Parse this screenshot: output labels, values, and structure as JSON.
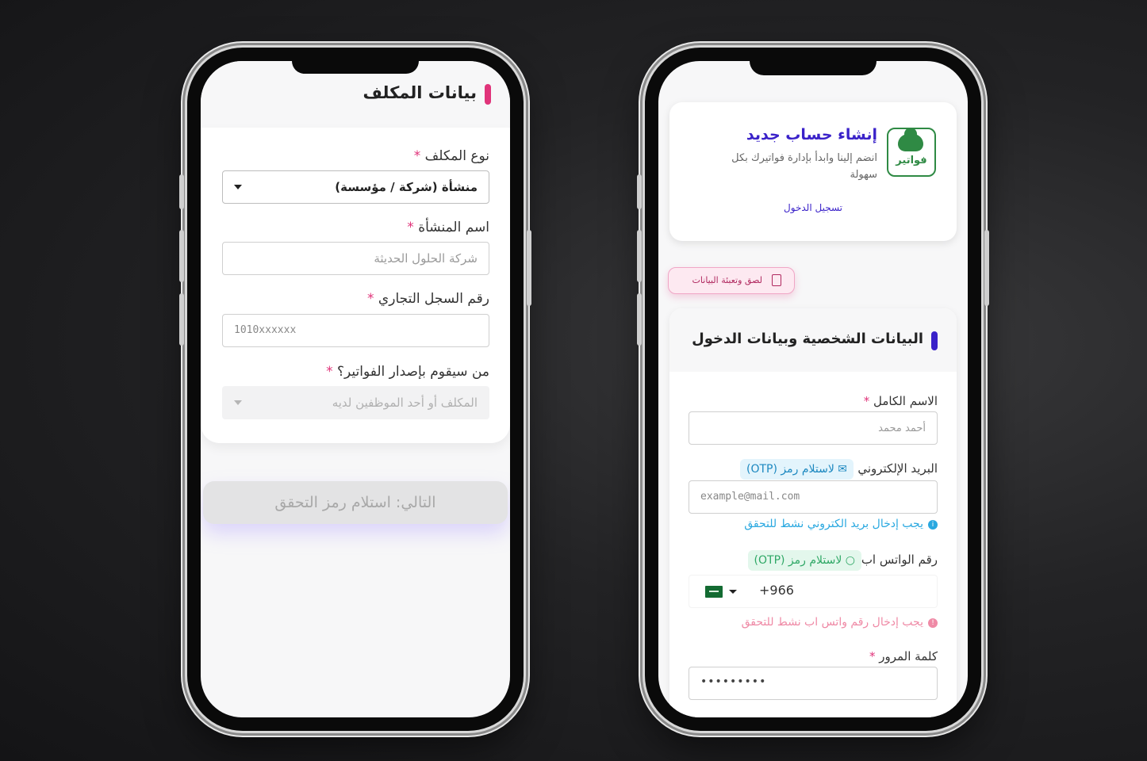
{
  "left_screen": {
    "section_title": "بيانات المكلف",
    "fields": {
      "taxpayer_type": {
        "label": "نوع المكلف",
        "value": "منشأة (شركة / مؤسسة)"
      },
      "establishment_name": {
        "label": "اسم المنشأة",
        "placeholder": "شركة الحلول الحديثة"
      },
      "commercial_register": {
        "label": "رقم السجل التجاري",
        "placeholder": "1010xxxxxx"
      },
      "invoice_issuer": {
        "label": "من سيقوم بإصدار الفواتير؟",
        "placeholder": "المكلف أو أحد الموظفين لديه"
      }
    },
    "required_mark": "*",
    "next_button": "التالي: استلام رمز التحقق"
  },
  "right_screen": {
    "logo_text": "فواتير",
    "title": "إنشاء حساب جديد",
    "subtitle": "انضم إلينا وابدأ بإدارة فواتيرك بكل سهولة",
    "login_link": "تسجيل الدخول",
    "paste_button": "لصق وتعبئة البيانات",
    "section_title": "البيانات الشخصية وبيانات الدخول",
    "required_mark": "*",
    "fields": {
      "full_name": {
        "label": "الاسم الكامل",
        "placeholder": "أحمد محمد"
      },
      "email": {
        "label": "البريد الإلكتروني",
        "otp_badge": "لاستلام رمز (OTP)",
        "placeholder": "example@mail.com",
        "hint": "يجب إدخال بريد الكتروني نشط للتحقق"
      },
      "whatsapp": {
        "label": "رقم الواتس اب",
        "otp_badge": "لاستلام رمز (OTP)",
        "country_code": "+966",
        "hint": "يجب إدخال رقم واتس اب نشط للتحقق"
      },
      "password": {
        "label": "كلمة المرور",
        "value": "•••••••••"
      }
    }
  },
  "colors": {
    "pink_accent": "#e0347a",
    "purple_accent": "#3a22c9",
    "brand_green": "#2f8a44",
    "info_blue": "#29a8e0",
    "otp_green": "#2fa866",
    "error_pink": "#ef8aa6"
  }
}
